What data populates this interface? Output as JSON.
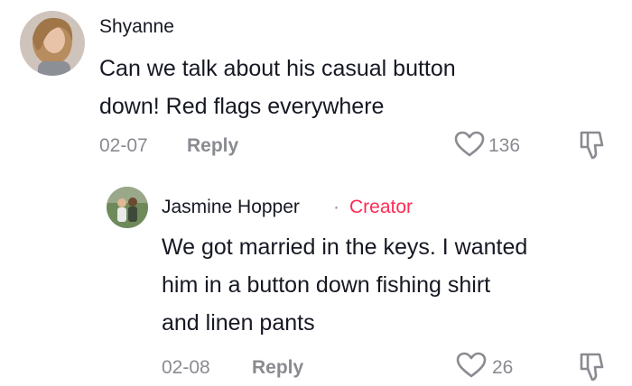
{
  "comment": {
    "username": "Shyanne",
    "text_line1": "Can we talk about his casual button",
    "text_line2": "down! Red flags everywhere",
    "date": "02-07",
    "reply_label": "Reply",
    "like_count": "136",
    "icons": {
      "like": "heart-outline-icon",
      "dislike": "thumbs-down-icon"
    }
  },
  "reply": {
    "username": "Jasmine Hopper",
    "separator": "·",
    "badge": "Creator",
    "badge_color": "#fe2c55",
    "text_line1": "We got married in the keys. I wanted",
    "text_line2": "him in a button down fishing shirt",
    "text_line3": "and linen pants",
    "date": "02-08",
    "reply_label": "Reply",
    "like_count": "26",
    "icons": {
      "like": "heart-outline-icon",
      "dislike": "thumbs-down-icon"
    }
  },
  "colors": {
    "text": "#161823",
    "muted": "#8a8b91",
    "accent": "#fe2c55"
  }
}
